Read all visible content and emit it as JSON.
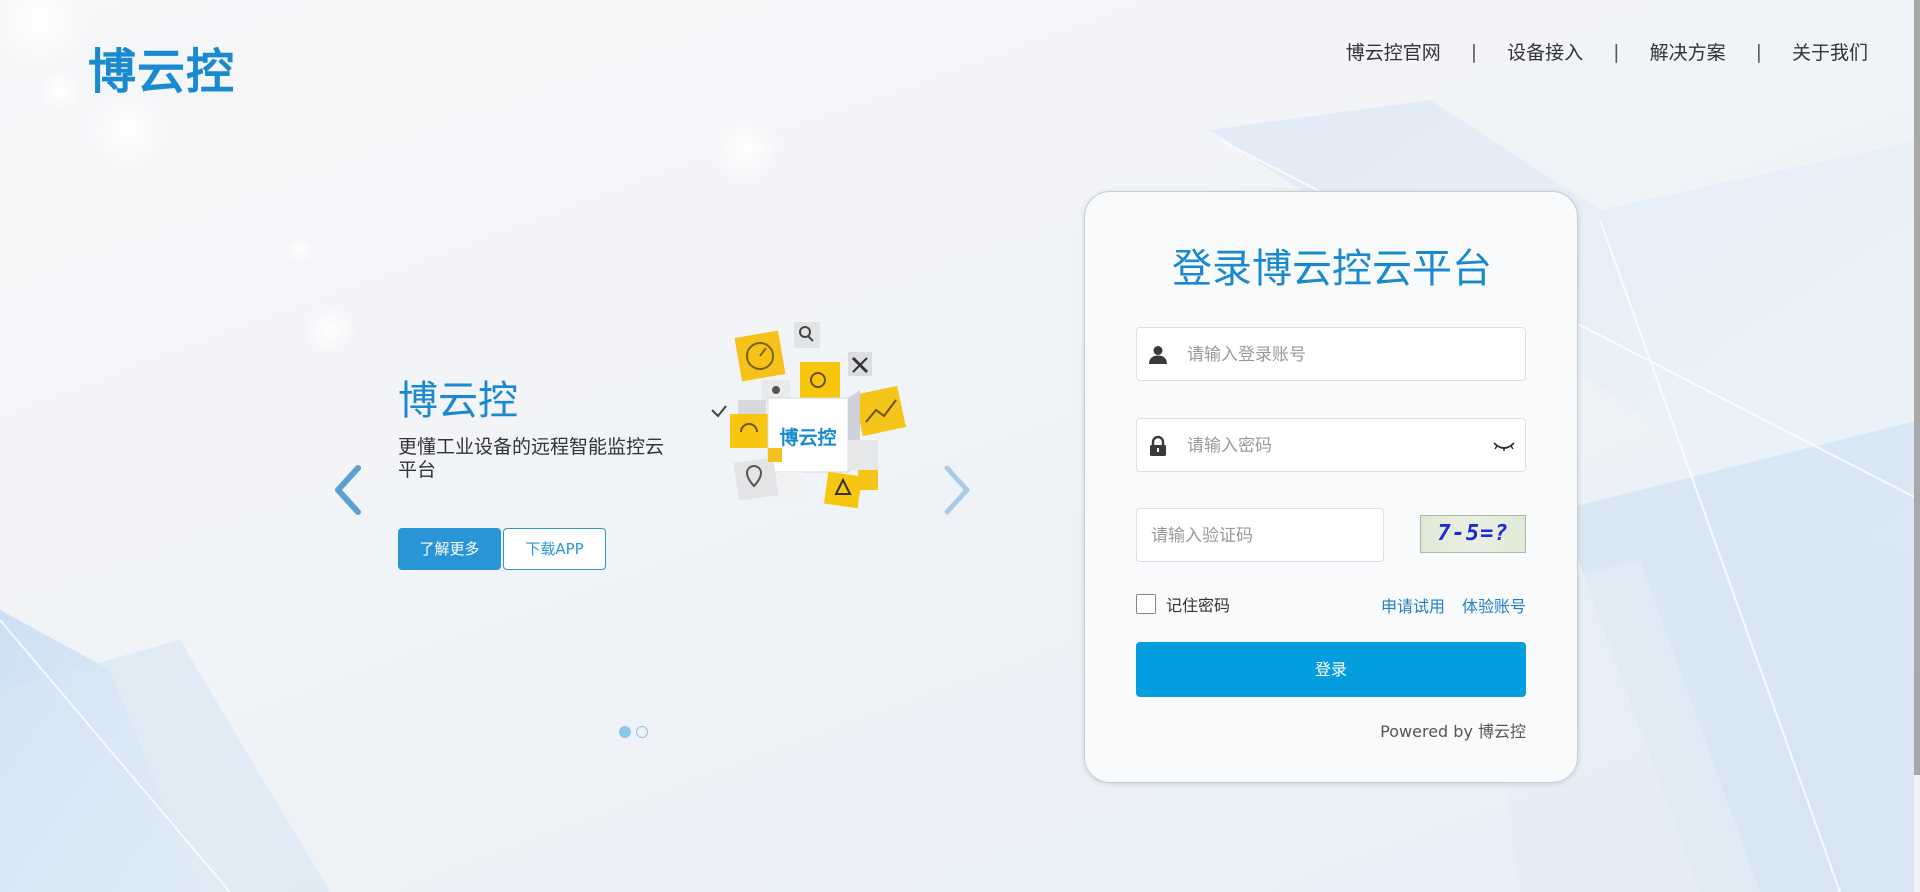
{
  "header": {
    "logo_text": "博云控",
    "nav": [
      {
        "label": "博云控官网"
      },
      {
        "label": "设备接入"
      },
      {
        "label": "解决方案"
      },
      {
        "label": "关于我们"
      }
    ],
    "separator": "|"
  },
  "carousel": {
    "title": "博云控",
    "description": "更懂工业设备的远程智能监控云平台",
    "learn_more_label": "了解更多",
    "download_app_label": "下载APP",
    "illustration_text": "博云控",
    "slide_count": 2,
    "active_slide": 1
  },
  "login": {
    "title": "登录博云控云平台",
    "username_placeholder": "请输入登录账号",
    "password_placeholder": "请输入密码",
    "captcha_placeholder": "请输入验证码",
    "captcha_text": "7-5=?",
    "remember_label": "记住密码",
    "apply_trial_label": "申请试用",
    "demo_account_label": "体验账号",
    "submit_label": "登录",
    "powered_by": "Powered by 博云控"
  },
  "colors": {
    "brand_blue": "#1a8ad0",
    "button_blue": "#039de0",
    "link_blue": "#1f7ec4"
  }
}
